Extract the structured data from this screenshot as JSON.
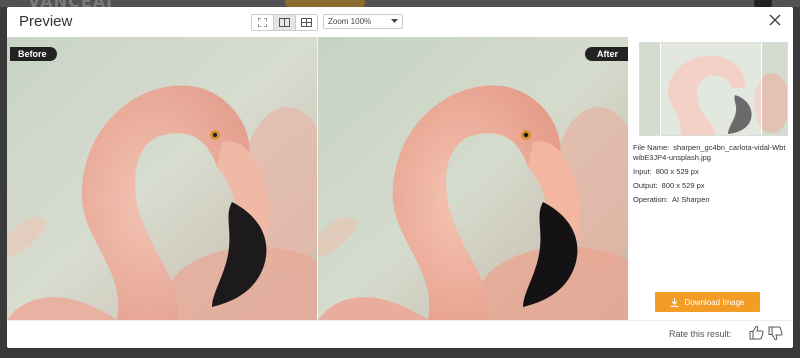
{
  "backdrop": {
    "logo_text": "VANCEAI"
  },
  "dialog": {
    "title": "Preview",
    "view_modes": [
      {
        "icon": "fullscreen-icon"
      },
      {
        "icon": "split-view-icon"
      },
      {
        "icon": "side-by-side-icon"
      }
    ],
    "zoom": {
      "value": "Zoom 100%"
    },
    "close_icon": "close-icon"
  },
  "compare": {
    "before_label": "Before",
    "after_label": "After"
  },
  "file_info": {
    "file_name_label": "File Name:",
    "file_name_value": "sharpen_gc4bn_carlota-vidal-WbtwibE3JP4-unsplash.jpg",
    "input_label": "Input:",
    "input_value": "800 x 529 px",
    "output_label": "Output:",
    "output_value": "800 x 529 px",
    "operation_label": "Operation:",
    "operation_value": "AI Sharpen"
  },
  "download": {
    "label": "Download Image",
    "icon": "download-icon"
  },
  "rating": {
    "label": "Rate this result:",
    "up_icon": "thumbs-up-icon",
    "down_icon": "thumbs-down-icon"
  },
  "colors": {
    "accent": "#f39c26",
    "label_bg": "#222222"
  }
}
